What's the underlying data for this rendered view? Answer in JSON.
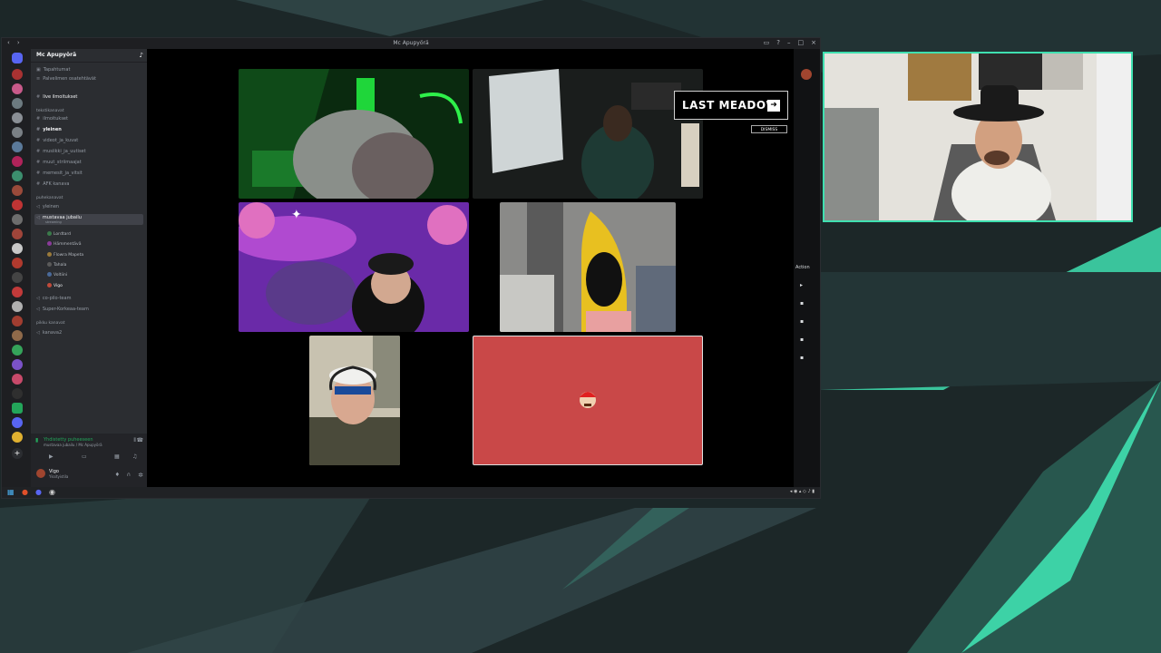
{
  "window": {
    "title": "Mc Apupyörä"
  },
  "server": {
    "name": "Mc Apupyörä"
  },
  "sidebar": {
    "top_items": [
      "Tapahtumat",
      "Palvelimen osatehtävät"
    ],
    "pinned": "live ilmoitukset",
    "categories": [
      {
        "label": "tekstikanavat",
        "channels": [
          "ilmoitukset",
          "yleinen",
          "videot_ja_kuvat",
          "musiikki_ja_uutiset",
          "muut_striimaajat",
          "memesit_ja_vitsit",
          "AFK kanava"
        ]
      },
      {
        "label": "puhekanavat",
        "channels": [
          "yleinen"
        ]
      },
      {
        "label": "pikku kanavat",
        "channels": [
          "kanava2"
        ]
      }
    ],
    "active_voice_channel": "mustavaa jubailu",
    "active_voice_sub": "streaming",
    "voice_users": [
      "Lordtard",
      "Hämmentävä",
      "Flowra Mapeta",
      "Tahala",
      "Voltiini",
      "Vigo"
    ],
    "other_voice": [
      "co-pilo-team",
      "Super-Korkeaa-team"
    ]
  },
  "voice_status": {
    "connected": "Yhdistetty puheeseen",
    "server": "mustavaa jubailu / Mc Apupyörä"
  },
  "user": {
    "name": "Vigo",
    "status": "Yksityistila"
  },
  "stage": {
    "banner": "LAST MEADOW",
    "dismiss": "DISMISS",
    "activity_label": "Action"
  },
  "colors": {
    "accent": "#3fe0b0",
    "red_tile": "#c94848",
    "discord_dark": "#2b2d31"
  }
}
